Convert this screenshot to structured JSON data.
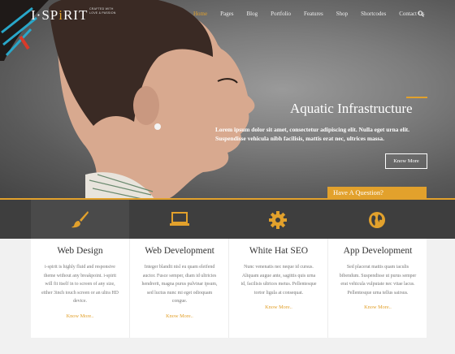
{
  "brand": {
    "logo_pre": "I·SP",
    "logo_accent": "i",
    "logo_post": "RIT",
    "tagline": "CRAFTED WITH LOVE & PASSION"
  },
  "nav": {
    "items": [
      "Home",
      "Pages",
      "Blog",
      "Portfolio",
      "Features",
      "Shop",
      "Shortcodes",
      "Contact Us"
    ],
    "active": "Home"
  },
  "hero": {
    "title": "Aquatic Infrastructure",
    "text": "Lorem ipsum dolor sit amet, consectetur adipiscing elit. Nulla eget urna elit. Suspendisse vehicula nibh facilisis, mattis erat nec, ultrices massa.",
    "button": "Know More"
  },
  "question_tab": "Have A Question?",
  "services": [
    {
      "icon": "paintbrush-icon",
      "title": "Web Design",
      "text": "i-spirit is highly fluid and responsive theme without any breakpoint. i-spirit will fit itself in to screen of any size, either 3inch touch screen or an ultra HD device.",
      "link": "Know More.."
    },
    {
      "icon": "laptop-icon",
      "title": "Web Development",
      "text": "Integer blandit nisl eu quam eleifend auctor. Fusce semper, diam id ultricies hendrerit, magna purus pulvinar ipsum, sed luctus nunc mi eget odioquam congue.",
      "link": "Know More.."
    },
    {
      "icon": "gear-icon",
      "title": "White Hat SEO",
      "text": "Nunc venenatis nec neque id cursus. Aliquam augue ante, sagittis quis urna id, facilisis ultrices metus. Pellentesque tortor ligula at consequat.",
      "link": "Know More.."
    },
    {
      "icon": "globe-icon",
      "title": "App Development",
      "text": "Sed placerat mattis quam iaculis bibendum. Suspendisse ut purus semper erat vehicula vulputate nec vitae lacus. Pellentesque urna tellus sairsus.",
      "link": "Know More.."
    }
  ],
  "colors": {
    "accent": "#e2a12c",
    "band": "#3e3e3e",
    "hero_bg": "#7d7d7d"
  }
}
